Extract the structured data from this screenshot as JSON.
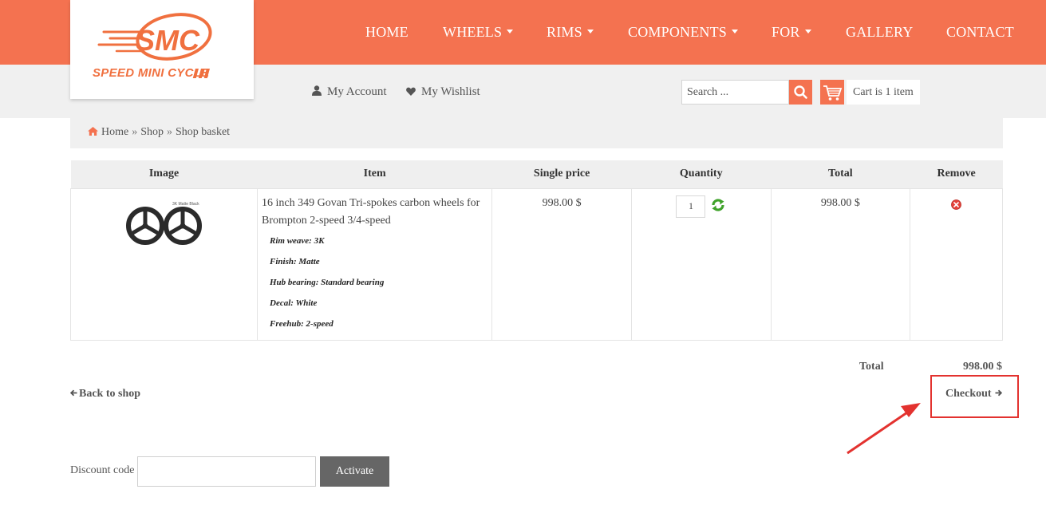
{
  "brand": {
    "logo_text": "SPEED MINI CYCLE",
    "logo_mark": "SMC",
    "color": "#f47250"
  },
  "nav": [
    {
      "label": "HOME",
      "dropdown": false
    },
    {
      "label": "WHEELS",
      "dropdown": true
    },
    {
      "label": "RIMS",
      "dropdown": true
    },
    {
      "label": "COMPONENTS",
      "dropdown": true
    },
    {
      "label": "FOR",
      "dropdown": true
    },
    {
      "label": "GALLERY",
      "dropdown": false
    },
    {
      "label": "CONTACT",
      "dropdown": false
    }
  ],
  "account": {
    "my_account": "My Account",
    "my_wishlist": "My Wishlist"
  },
  "search": {
    "placeholder": "Search ..."
  },
  "cart_summary": "Cart is 1 item",
  "breadcrumb": {
    "home": "Home",
    "sep": "»",
    "shop": "Shop",
    "current": "Shop basket"
  },
  "table": {
    "headers": [
      "Image",
      "Item",
      "Single price",
      "Quantity",
      "Total",
      "Remove"
    ],
    "rows": [
      {
        "image_label": "3K Matte Black",
        "name": "16 inch 349 Govan Tri-spokes carbon wheels for Brompton 2-speed 3/4-speed",
        "attributes": [
          "Rim weave: 3K",
          "Finish: Matte",
          "Hub bearing: Standard bearing",
          "Decal: White",
          "Freehub: 2-speed"
        ],
        "single_price": "998.00 $",
        "quantity": "1",
        "total": "998.00 $"
      }
    ]
  },
  "totals": {
    "label": "Total",
    "value": "998.00 $"
  },
  "actions": {
    "back": "Back to shop",
    "checkout": "Checkout"
  },
  "discount": {
    "label": "Discount code",
    "value": "",
    "button": "Activate"
  },
  "colors": {
    "accent": "#f47250",
    "annotation": "#e3322f",
    "button_gray": "#666666"
  }
}
